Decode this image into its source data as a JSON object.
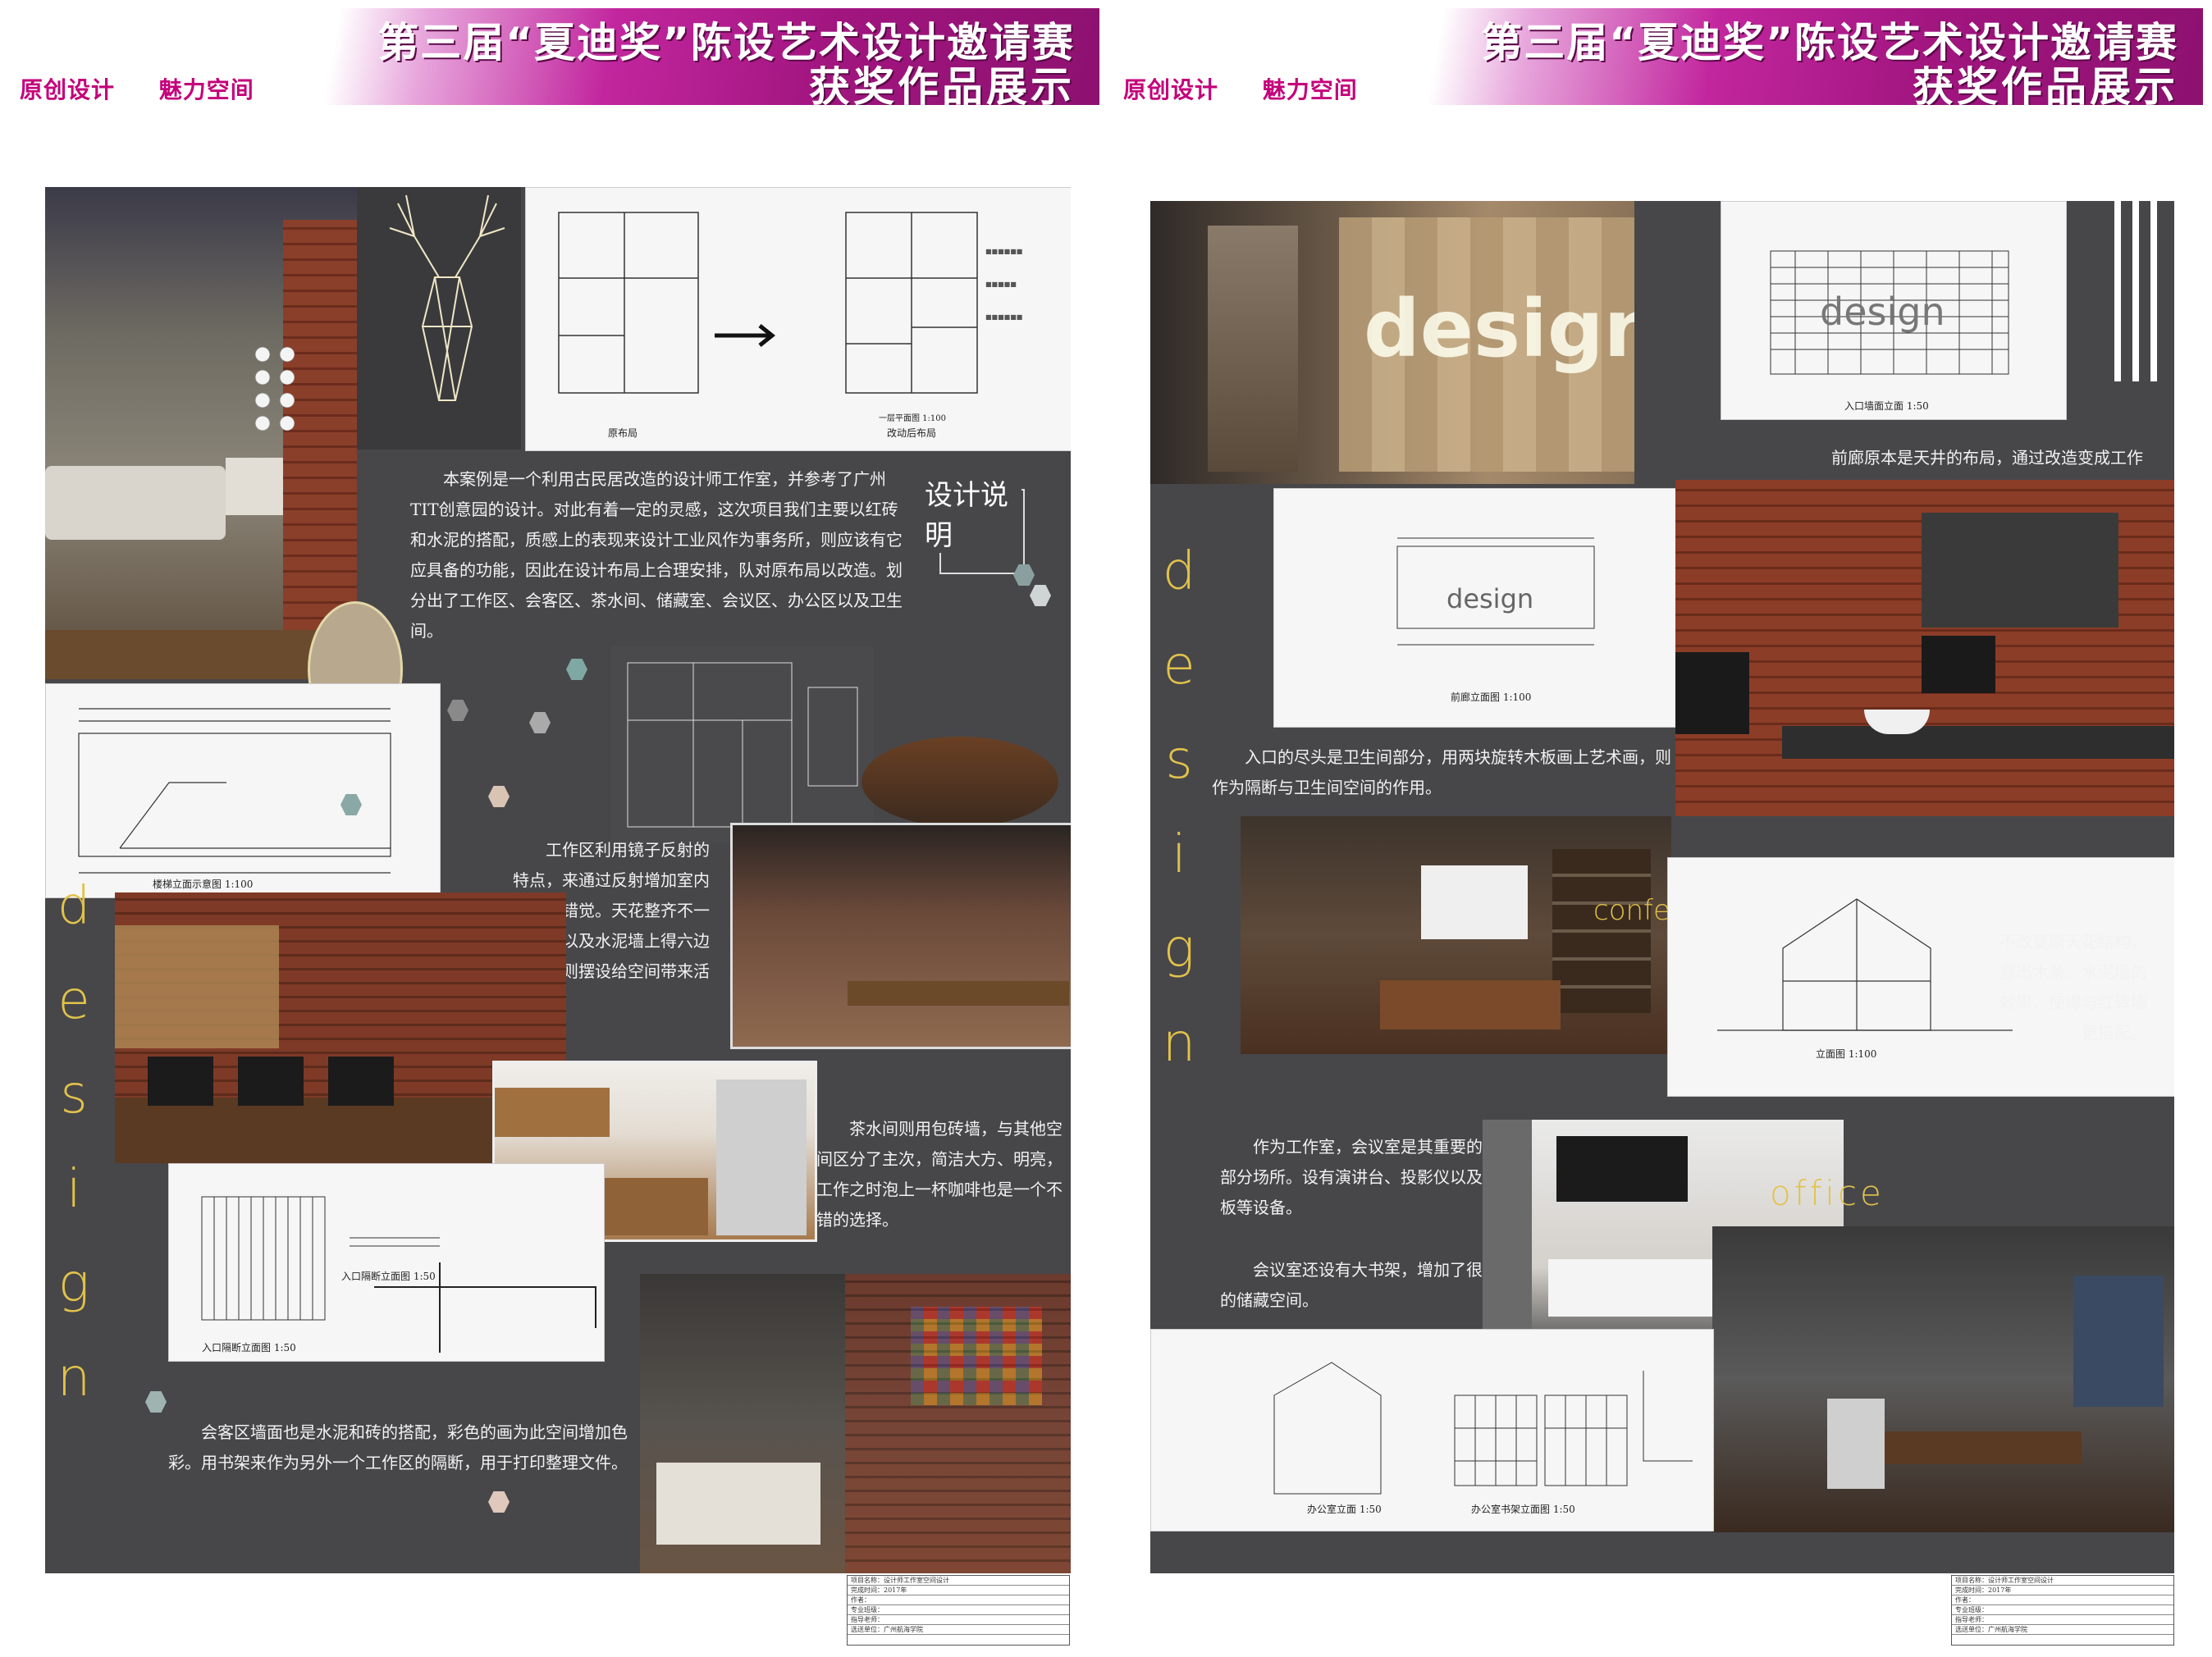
{
  "banner": {
    "title_line1": "第三届“夏迪奖”陈设艺术设计邀请赛",
    "title_line2": "获奖作品展示",
    "tag1": "原创设计",
    "tag2": "魅力空间"
  },
  "left": {
    "plan_caption_before": "原布局",
    "plan_caption_after": "改动后布局",
    "plan_scale": "一层平面图 1:100",
    "section_title": "设计说明",
    "para_intro": "本案例是一个利用古民居改造的设计师工作室，并参考了广州TIT创意园的设计。对此有着一定的灵感，这次项目我们主要以红砖和水泥的搭配，质感上的表现来设计工业风作为事务所，则应该有它应具备的功能，因此在设计布局上合理安排，队对原布局以改造。划分出了工作区、会客区、茶水间、储藏室、会议区、办公区以及卫生间。",
    "stair_caption": "楼梯立面示意图 1:100",
    "para_work": "工作区利用镜子反射的特点，来通过反射增加室内空间的错觉。天花整齐不一得造型以及水泥墙上得六边形不规则摆设给空间带来活跃感。",
    "para_tea": "茶水间则用包砖墙，与其他空间区分了主次，简洁大方、明亮，工作之时泡上一杯咖啡也是一个不错的选择。",
    "para_lounge": "会客区墙面也是水泥和砖的搭配，彩色的画为此空间增加色彩。用书架来作为另外一个工作区的隔断，用于打印整理文件。",
    "entrance_caption1": "入口隔断立面图 1:50",
    "entrance_caption2": "入口隔断立面图 1:50",
    "vertical_word": [
      "d",
      "e",
      "s",
      "i",
      "g",
      "n"
    ]
  },
  "right": {
    "para_corridor": "前廊原本是天井的布局，通过改造变成工作室的入口门面。长短变化的木头围出“design”字样，用发光材质做出灯光效果。",
    "entrance_caption": "入口墙面立面 1:50",
    "corridor_caption": "前廊立面图 1:100",
    "design_word": "design",
    "para_wc": "入口的尽头是卫生间部分，用两块旋转木板画上艺术画，则作为隔断与卫生间空间的作用。",
    "conference_label": "conference room",
    "para_ceiling": "不改变原天花结构，露出木条，水泥墙的效果，使得与红砖墙更搭配。",
    "section_caption": "立面图 1:100",
    "para_meeting1": "作为工作室，会议室是其重要的一部分场所。设有演讲台、投影仪以及黑板等设备。",
    "para_meeting2": "会议室还设有大书架，增加了很大的储藏空间。",
    "office_label": "office",
    "office_caption1": "办公室立面 1:50",
    "office_caption2": "办公室书架立面图 1:50",
    "vertical_word": [
      "d",
      "e",
      "s",
      "i",
      "g",
      "n"
    ]
  },
  "titleblock_left": [
    "项目名称：设计师工作室空间设计",
    "作者：",
    "专业班级：",
    "指导老师：",
    "完成时间：2017年",
    "选送单位：广州航海学院"
  ],
  "titleblock_right": [
    "项目名称：设计师工作室空间设计",
    "作者：",
    "专业班级：",
    "指导老师：",
    "完成时间：2017年",
    "选送单位：广州航海学院"
  ],
  "colors": {
    "board": "#47474a",
    "accent": "#e2c24a",
    "banner": "#a1157f",
    "brick": "#9a4a32"
  }
}
